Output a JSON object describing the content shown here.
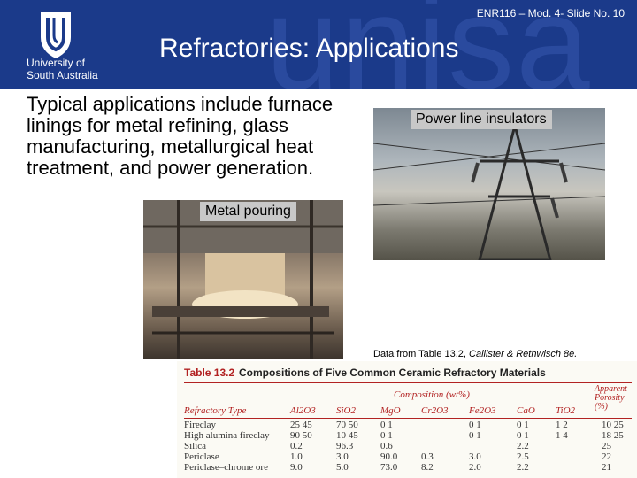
{
  "header": {
    "logo_line1": "University of",
    "logo_line2": "South Australia",
    "watermark": "unisa",
    "slide_number": "ENR116 – Mod. 4- Slide No. 10",
    "title": "Refractories: Applications"
  },
  "body_text": "Typical applications include furnace linings for metal refining, glass manufacturing, metallurgical heat treatment, and power generation.",
  "captions": {
    "metal": "Metal pouring",
    "power": "Power line insulators"
  },
  "source": {
    "prefix": "Data from Table 13.2, ",
    "citation": "Callister & Rethwisch 8e."
  },
  "table": {
    "label": "Table 13.2",
    "title": "Compositions of Five Common Ceramic Refractory Materials",
    "composition_header": "Composition (wt%)",
    "porosity_header": "Apparent Porosity (%)",
    "columns": [
      "Refractory Type",
      "Al2O3",
      "SiO2",
      "MgO",
      "Cr2O3",
      "Fe2O3",
      "CaO",
      "TiO2",
      "Apparent Porosity (%)"
    ],
    "rows": [
      [
        "Fireclay",
        "25 45",
        "70 50",
        "0 1",
        "",
        "0 1",
        "0 1",
        "1 2",
        "10 25"
      ],
      [
        "High alumina fireclay",
        "90 50",
        "10 45",
        "0 1",
        "",
        "0 1",
        "0 1",
        "1 4",
        "18 25"
      ],
      [
        "Silica",
        "0.2",
        "96.3",
        "0.6",
        "",
        "",
        "2.2",
        "",
        "25"
      ],
      [
        "Periclase",
        "1.0",
        "3.0",
        "90.0",
        "0.3",
        "3.0",
        "2.5",
        "",
        "22"
      ],
      [
        "Periclase–chrome ore",
        "9.0",
        "5.0",
        "73.0",
        "8.2",
        "2.0",
        "2.2",
        "",
        "21"
      ]
    ]
  },
  "colors": {
    "header_bg": "#1b3a8a",
    "header_text": "#ffffff",
    "caption_bg": "#c8c8c8",
    "table_accent": "#b22222"
  }
}
